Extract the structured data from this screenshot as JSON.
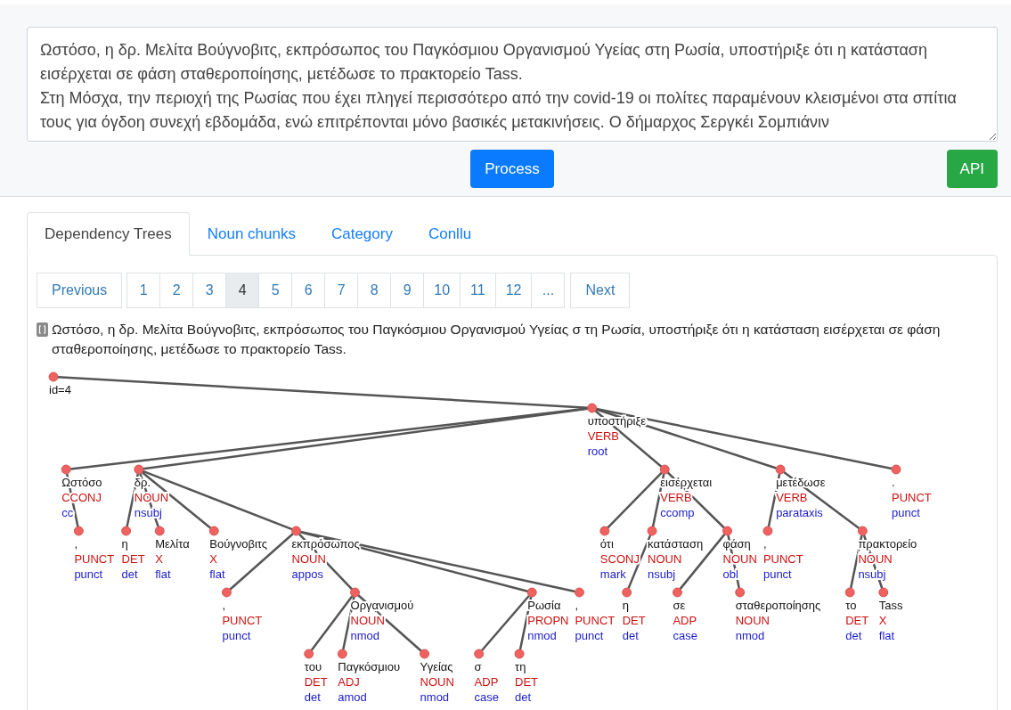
{
  "input": {
    "value": "Ωστόσο, η δρ. Μελίτα Βούγνοβιτς, εκπρόσωπος του Παγκόσμιου Οργανισμού Υγείας στη Ρωσία, υποστήριξε ότι η κατάσταση εισέρχεται σε φάση σταθεροποίησης, μετέδωσε το πρακτορείο Tass.\nΣτη Μόσχα, την περιοχή της Ρωσίας που έχει πληγεί περισσότερο από την covid-19 οι πολίτες παραμένουν κλεισμένοι στα σπίτια τους για όγδοη συνεχή εβδομάδα, ενώ επιτρέπονται μόνο βασικές μετακινήσεις. Ο δήμαρχος Σεργκέι Σομπιάνιν"
  },
  "process_button": {
    "label": "Process"
  },
  "api_button": {
    "label": "API"
  },
  "tabs": [
    {
      "label": "Dependency Trees",
      "selected": true
    },
    {
      "label": "Noun chunks",
      "selected": false
    },
    {
      "label": "Category",
      "selected": false
    },
    {
      "label": "Conllu",
      "selected": false
    }
  ],
  "pagination": {
    "previous": "Previous",
    "next": "Next",
    "pages": [
      {
        "label": "1",
        "selected": false
      },
      {
        "label": "2",
        "selected": false
      },
      {
        "label": "3",
        "selected": false
      },
      {
        "label": "4",
        "selected": true
      },
      {
        "label": "5",
        "selected": false
      },
      {
        "label": "6",
        "selected": false
      },
      {
        "label": "7",
        "selected": false
      },
      {
        "label": "8",
        "selected": false
      },
      {
        "label": "9",
        "selected": false
      },
      {
        "label": "10",
        "selected": false
      },
      {
        "label": "11",
        "selected": false
      },
      {
        "label": "12",
        "selected": false
      },
      {
        "label": "...",
        "selected": false
      }
    ]
  },
  "sentence": {
    "text": "Ωστόσο, η δρ. Μελίτα Βούγνοβιτς, εκπρόσωπος του Παγκόσμιου Οργανισμού Υγείας σ τη Ρωσία, υποστήριξε ότι η κατάσταση εισέρχεται σε φάση σταθεροποίησης, μετέδωσε το πρακτορείο Tass."
  },
  "tree": {
    "root_label": "id=4",
    "children": [
      {
        "word": "υποστήριξε",
        "pos": "VERB",
        "deprel": "root",
        "left_children": [
          {
            "word": "Ωστόσο",
            "pos": "CCONJ",
            "deprel": "cc",
            "children": [
              {
                "word": ",",
                "pos": "PUNCT",
                "deprel": "punct"
              }
            ]
          },
          {
            "word": "δρ.",
            "pos": "NOUN",
            "deprel": "nsubj",
            "left_children": [
              {
                "word": "η",
                "pos": "DET",
                "deprel": "det"
              }
            ],
            "children": [
              {
                "word": "Μελίτα",
                "pos": "X",
                "deprel": "flat"
              },
              {
                "word": "Βούγνοβιτς",
                "pos": "X",
                "deprel": "flat"
              },
              {
                "word": "εκπρόσωπος",
                "pos": "NOUN",
                "deprel": "appos",
                "left_children": [
                  {
                    "word": ",",
                    "pos": "PUNCT",
                    "deprel": "punct"
                  }
                ],
                "children": [
                  {
                    "word": "Οργανισμού",
                    "pos": "NOUN",
                    "deprel": "nmod",
                    "left_children": [
                      {
                        "word": "του",
                        "pos": "DET",
                        "deprel": "det"
                      },
                      {
                        "word": "Παγκόσμιου",
                        "pos": "ADJ",
                        "deprel": "amod"
                      }
                    ],
                    "children": [
                      {
                        "word": "Υγείας",
                        "pos": "NOUN",
                        "deprel": "nmod"
                      }
                    ]
                  },
                  {
                    "word": "Ρωσία",
                    "pos": "PROPN",
                    "deprel": "nmod",
                    "left_children": [
                      {
                        "word": "σ",
                        "pos": "ADP",
                        "deprel": "case"
                      },
                      {
                        "word": "τη",
                        "pos": "DET",
                        "deprel": "det"
                      }
                    ]
                  },
                  {
                    "word": ",",
                    "pos": "PUNCT",
                    "deprel": "punct"
                  }
                ]
              }
            ]
          }
        ],
        "children": [
          {
            "word": "εισέρχεται",
            "pos": "VERB",
            "deprel": "ccomp",
            "left_children": [
              {
                "word": "ότι",
                "pos": "SCONJ",
                "deprel": "mark"
              },
              {
                "word": "κατάσταση",
                "pos": "NOUN",
                "deprel": "nsubj",
                "left_children": [
                  {
                    "word": "η",
                    "pos": "DET",
                    "deprel": "det"
                  }
                ]
              }
            ],
            "children": [
              {
                "word": "φάση",
                "pos": "NOUN",
                "deprel": "obl",
                "left_children": [
                  {
                    "word": "σε",
                    "pos": "ADP",
                    "deprel": "case"
                  }
                ],
                "children": [
                  {
                    "word": "σταθεροποίησης",
                    "pos": "NOUN",
                    "deprel": "nmod"
                  }
                ]
              }
            ]
          },
          {
            "word": "μετέδωσε",
            "pos": "VERB",
            "deprel": "parataxis",
            "left_children": [
              {
                "word": ",",
                "pos": "PUNCT",
                "deprel": "punct"
              }
            ],
            "children": [
              {
                "word": "πρακτορείο",
                "pos": "NOUN",
                "deprel": "nsubj",
                "left_children": [
                  {
                    "word": "το",
                    "pos": "DET",
                    "deprel": "det"
                  }
                ],
                "children": [
                  {
                    "word": "Tass",
                    "pos": "X",
                    "deprel": "flat"
                  }
                ]
              }
            ]
          },
          {
            "word": ".",
            "pos": "PUNCT",
            "deprel": "punct"
          }
        ]
      }
    ]
  }
}
